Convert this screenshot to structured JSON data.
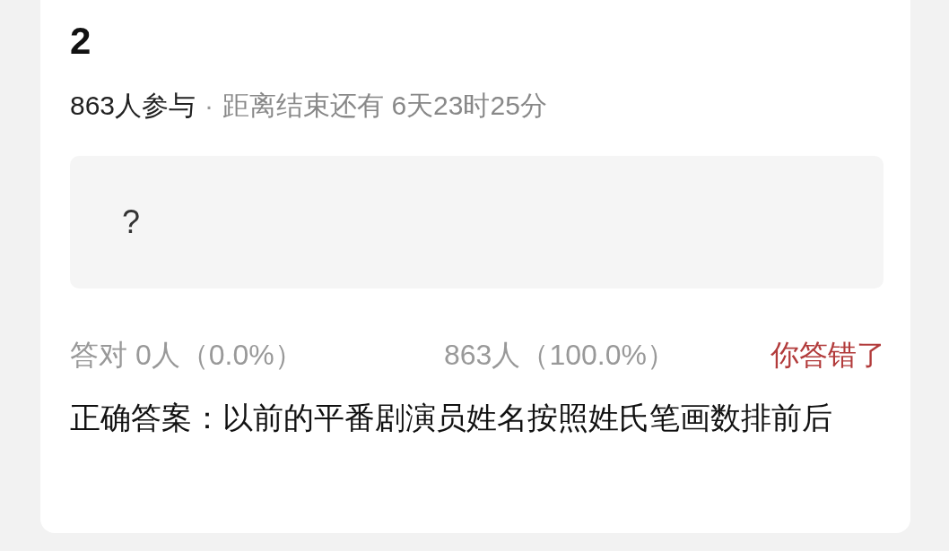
{
  "question": {
    "number": "2"
  },
  "meta": {
    "participants": "863人参与",
    "separator": "·",
    "countdown": "距离结束还有 6天23时25分"
  },
  "options": [
    {
      "label": "?"
    }
  ],
  "results": {
    "correct": "答对 0人（0.0%）",
    "wrong": "863人（100.0%）",
    "verdict": "你答错了",
    "user_correct": false
  },
  "answer": "正确答案：以前的平番剧演员姓名按照姓氏笔画数排前后"
}
